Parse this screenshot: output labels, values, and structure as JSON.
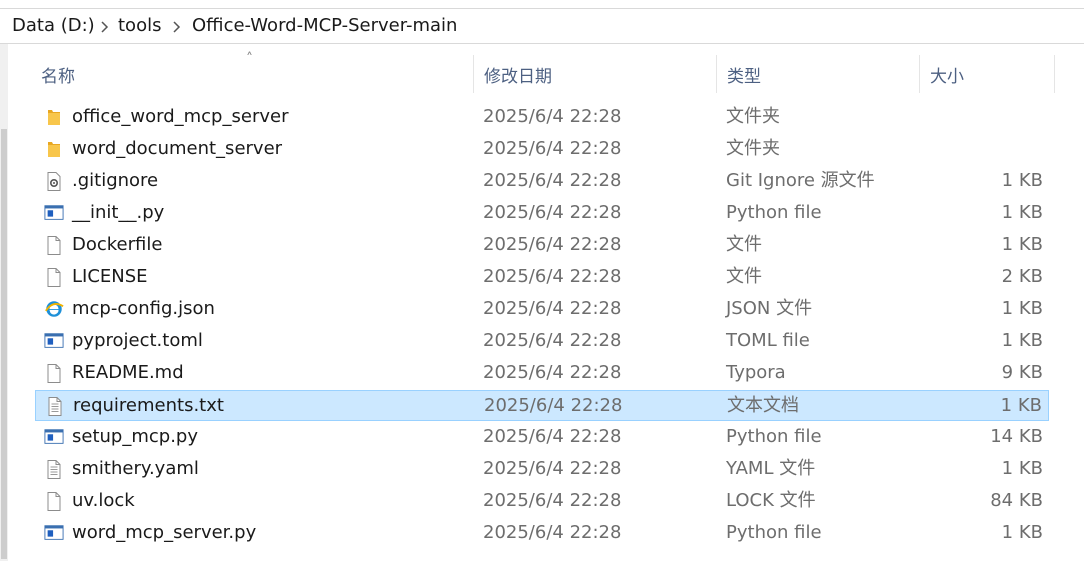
{
  "breadcrumb": [
    "Data (D:)",
    "tools",
    "Office-Word-MCP-Server-main"
  ],
  "columns": {
    "name": "名称",
    "date": "修改日期",
    "type": "类型",
    "size": "大小"
  },
  "files": [
    {
      "name": "office_word_mcp_server",
      "date": "2025/6/4 22:28",
      "type": "文件夹",
      "size": "",
      "icon": "folder-icon"
    },
    {
      "name": "word_document_server",
      "date": "2025/6/4 22:28",
      "type": "文件夹",
      "size": "",
      "icon": "folder-icon"
    },
    {
      "name": ".gitignore",
      "date": "2025/6/4 22:28",
      "type": "Git Ignore 源文件",
      "size": "1 KB",
      "icon": "gear-file-icon"
    },
    {
      "name": "__init__.py",
      "date": "2025/6/4 22:28",
      "type": "Python file",
      "size": "1 KB",
      "icon": "python-file-icon"
    },
    {
      "name": "Dockerfile",
      "date": "2025/6/4 22:28",
      "type": "文件",
      "size": "1 KB",
      "icon": "blank-file-icon"
    },
    {
      "name": "LICENSE",
      "date": "2025/6/4 22:28",
      "type": "文件",
      "size": "2 KB",
      "icon": "blank-file-icon"
    },
    {
      "name": "mcp-config.json",
      "date": "2025/6/4 22:28",
      "type": "JSON 文件",
      "size": "1 KB",
      "icon": "edge-browser-icon"
    },
    {
      "name": "pyproject.toml",
      "date": "2025/6/4 22:28",
      "type": "TOML file",
      "size": "1 KB",
      "icon": "python-file-icon"
    },
    {
      "name": "README.md",
      "date": "2025/6/4 22:28",
      "type": "Typora",
      "size": "9 KB",
      "icon": "blank-file-icon"
    },
    {
      "name": "requirements.txt",
      "date": "2025/6/4 22:28",
      "type": "文本文档",
      "size": "1 KB",
      "icon": "text-file-icon",
      "selected": true
    },
    {
      "name": "setup_mcp.py",
      "date": "2025/6/4 22:28",
      "type": "Python file",
      "size": "14 KB",
      "icon": "python-file-icon"
    },
    {
      "name": "smithery.yaml",
      "date": "2025/6/4 22:28",
      "type": "YAML 文件",
      "size": "1 KB",
      "icon": "text-file-icon"
    },
    {
      "name": "uv.lock",
      "date": "2025/6/4 22:28",
      "type": "LOCK 文件",
      "size": "84 KB",
      "icon": "blank-file-icon"
    },
    {
      "name": "word_mcp_server.py",
      "date": "2025/6/4 22:28",
      "type": "Python file",
      "size": "1 KB",
      "icon": "python-file-icon"
    }
  ],
  "colors": {
    "selection": "#cce8ff",
    "selection_border": "#99d1ff",
    "header_text": "#4d6082",
    "folder": "#f5c242"
  }
}
